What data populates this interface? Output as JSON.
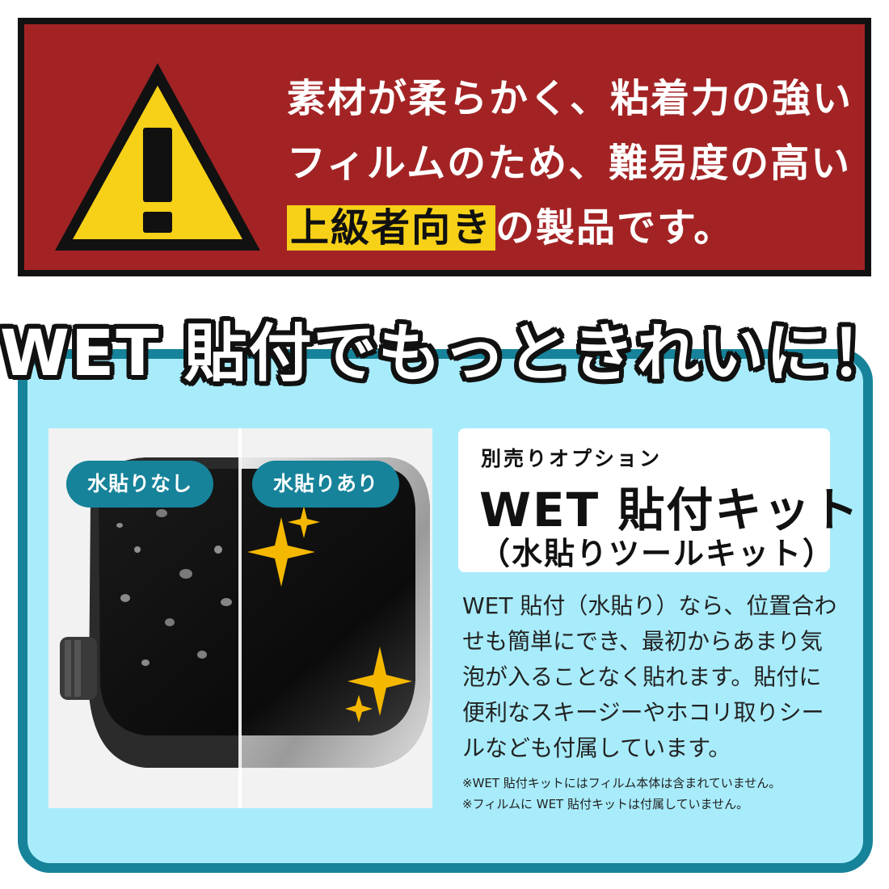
{
  "warning": {
    "icon": "warning-triangle-icon",
    "line1": "素材が柔らかく、粘着力の強い",
    "line2": "フィルムのため、難易度の高い",
    "line3_highlight": "上級者向き",
    "line3_rest": "の製品です。",
    "colors": {
      "background": "#a32324",
      "triangle": "#f7d117",
      "highlight": "#f7d117"
    }
  },
  "wet": {
    "headline": "WET 貼付でもっときれいに！",
    "photo": {
      "label_left": "水貼りなし",
      "label_right": "水貼りあり",
      "icons": [
        "smartwatch-icon",
        "sparkle-icon"
      ]
    },
    "kit": {
      "subtitle": "別売りオプション",
      "title": "WET 貼付キット",
      "paren": "（水貼りツールキット）"
    },
    "description": [
      "WET 貼付（水貼り）なら、位置合わ",
      "せも簡単にでき、最初からあまり気",
      "泡が入ることなく貼れます。貼付に",
      "便利なスキージーやホコリ取りシー",
      "ルなども付属しています。"
    ],
    "notes": [
      "※WET 貼付キットにはフィルム本体は含まれていません。",
      "※フィルムに WET 貼付キットは付属していません。"
    ],
    "colors": {
      "panel": "#a8ecfb",
      "border": "#16839a",
      "pill": "#16839a"
    }
  }
}
